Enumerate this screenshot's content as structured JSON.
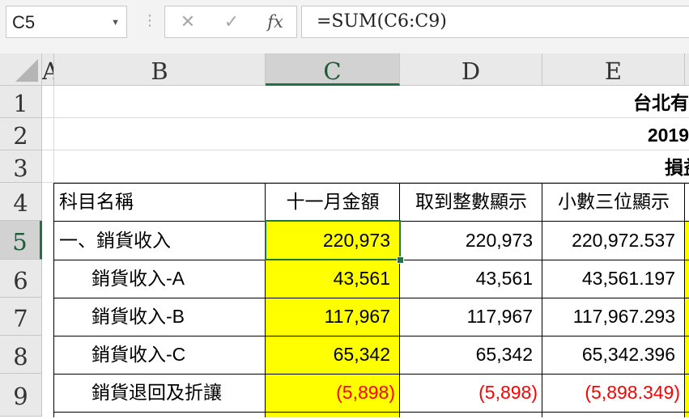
{
  "formula_bar": {
    "name_box": "C5",
    "formula": "=SUM(C6:C9)",
    "cancel_icon": "close-icon",
    "enter_icon": "check-icon",
    "fx_label": "fx"
  },
  "columns": [
    "A",
    "B",
    "C",
    "D",
    "E"
  ],
  "rows": [
    "1",
    "2",
    "3",
    "4",
    "5",
    "6",
    "7",
    "8",
    "9"
  ],
  "active_cell": "C5",
  "title_rows": {
    "r1": "台北有",
    "r2": "2019",
    "r3": "損益"
  },
  "table": {
    "headers": [
      "科目名稱",
      "十一月金額",
      "取到整數顯示",
      "小數三位顯示"
    ],
    "rows": [
      {
        "name": "一、銷貨收入",
        "c": "220,973",
        "d": "220,973",
        "e": "220,972.537",
        "negative": false
      },
      {
        "name": "銷貨收入-A",
        "c": "43,561",
        "d": "43,561",
        "e": "43,561.197",
        "negative": false
      },
      {
        "name": "銷貨收入-B",
        "c": "117,967",
        "d": "117,967",
        "e": "117,967.293",
        "negative": false
      },
      {
        "name": "銷貨收入-C",
        "c": "65,342",
        "d": "65,342",
        "e": "65,342.396",
        "negative": false
      },
      {
        "name": "銷貨退回及折讓",
        "c": "(5,898)",
        "d": "(5,898)",
        "e": "(5,898.349)",
        "negative": true
      }
    ]
  },
  "colors": {
    "highlight": "#ffff00",
    "negative": "#ff0000",
    "selection": "#217346"
  }
}
